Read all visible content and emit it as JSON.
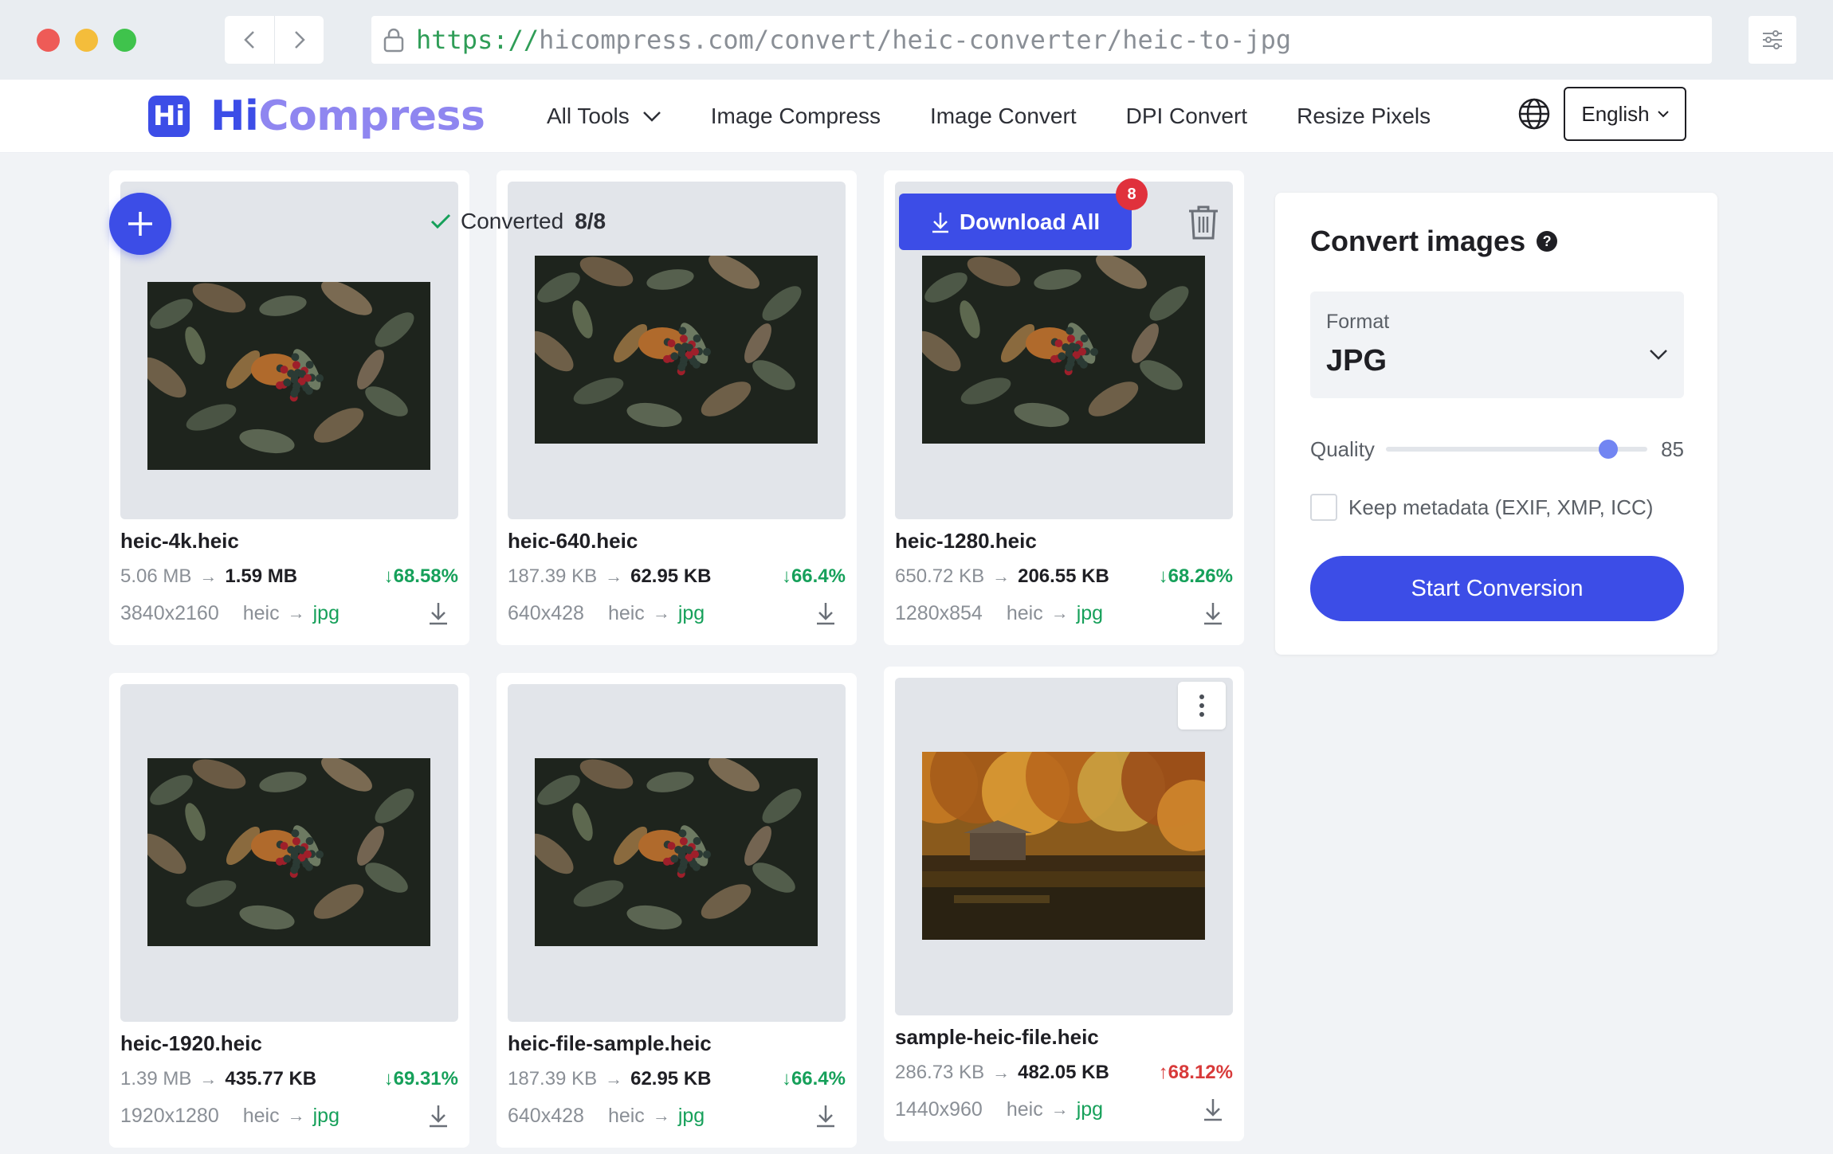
{
  "browser": {
    "url_scheme": "https://",
    "url_rest": "hicompress.com/convert/heic-converter/heic-to-jpg"
  },
  "header": {
    "logo_mark": "Hi",
    "logo_hi": "Hi",
    "logo_compress": "Compress",
    "nav": [
      {
        "label": "All Tools",
        "icon": "chevron-down-icon"
      },
      {
        "label": "Image Compress"
      },
      {
        "label": "Image Convert"
      },
      {
        "label": "DPI Convert"
      },
      {
        "label": "Resize Pixels"
      }
    ],
    "globe_icon": "globe-icon",
    "language": "English"
  },
  "toolbar": {
    "add_icon": "plus-icon",
    "converted_label": "Converted",
    "converted_count": "8/8",
    "download_all_label": "Download All",
    "download_badge": "8",
    "trash_icon": "trash-icon"
  },
  "files": [
    {
      "name": "heic-4k.heic",
      "old_size": "5.06 MB",
      "new_size": "1.59 MB",
      "change": "68.58%",
      "direction": "down",
      "dims": "3840x2160",
      "from": "heic",
      "to": "jpg",
      "image": "berries-leaves-photo"
    },
    {
      "name": "heic-640.heic",
      "old_size": "187.39 KB",
      "new_size": "62.95 KB",
      "change": "66.4%",
      "direction": "down",
      "dims": "640x428",
      "from": "heic",
      "to": "jpg",
      "image": "berries-leaves-photo"
    },
    {
      "name": "heic-1280.heic",
      "old_size": "650.72 KB",
      "new_size": "206.55 KB",
      "change": "68.26%",
      "direction": "down",
      "dims": "1280x854",
      "from": "heic",
      "to": "jpg",
      "image": "berries-leaves-photo"
    },
    {
      "name": "heic-1920.heic",
      "old_size": "1.39 MB",
      "new_size": "435.77 KB",
      "change": "69.31%",
      "direction": "down",
      "dims": "1920x1280",
      "from": "heic",
      "to": "jpg",
      "image": "berries-leaves-photo"
    },
    {
      "name": "heic-file-sample.heic",
      "old_size": "187.39 KB",
      "new_size": "62.95 KB",
      "change": "66.4%",
      "direction": "down",
      "dims": "640x428",
      "from": "heic",
      "to": "jpg",
      "image": "berries-leaves-photo"
    },
    {
      "name": "sample-heic-file.heic",
      "old_size": "286.73 KB",
      "new_size": "482.05 KB",
      "change": "68.12%",
      "direction": "up",
      "dims": "1440x960",
      "from": "heic",
      "to": "jpg",
      "image": "autumn-lake-cabin-photo"
    }
  ],
  "panel": {
    "title": "Convert images",
    "help_icon": "question-icon",
    "format_label": "Format",
    "format_value": "JPG",
    "quality_label": "Quality",
    "quality_value": "85",
    "quality_fraction": 0.85,
    "metadata_label": "Keep metadata (EXIF, XMP, ICC)",
    "metadata_checked": false,
    "start_label": "Start Conversion"
  },
  "colors": {
    "accent": "#3c4de7",
    "success": "#16a05a",
    "danger": "#d83a3a",
    "badge": "#e0313c"
  }
}
